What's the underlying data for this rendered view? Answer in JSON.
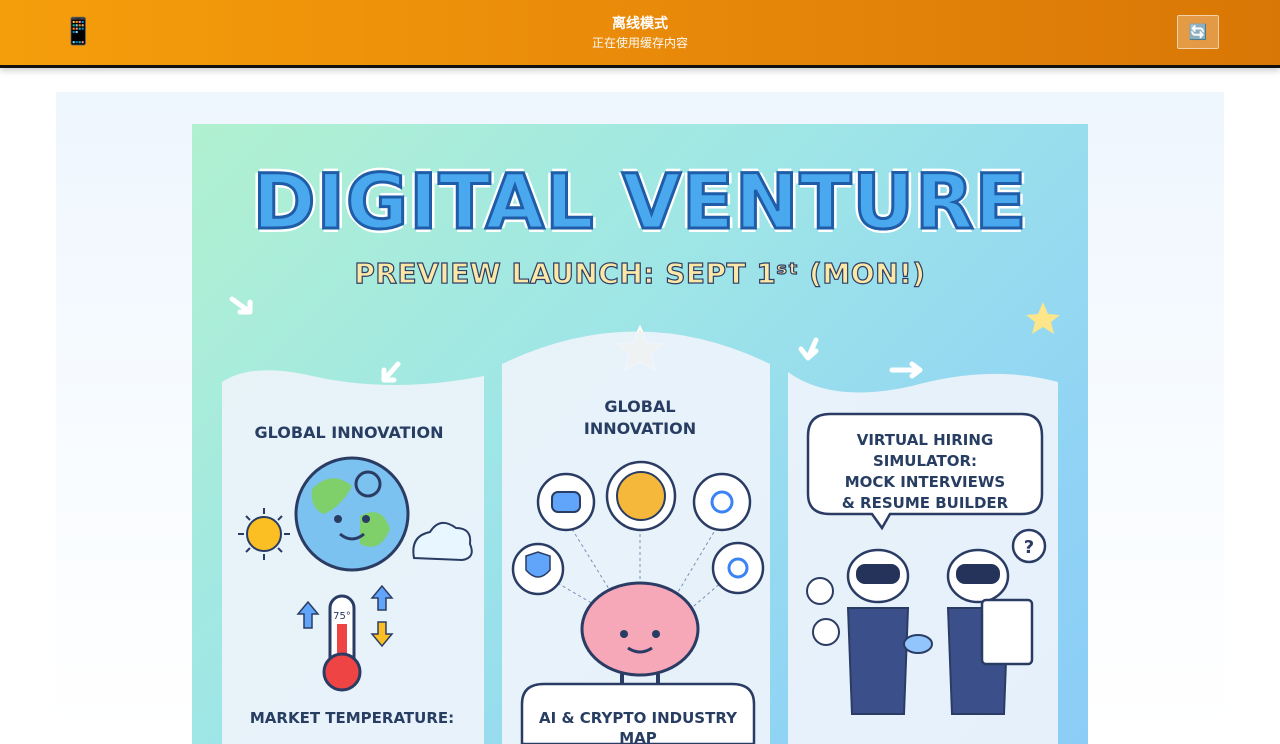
{
  "header": {
    "device_icon": "📱",
    "title": "离线模式",
    "subtitle": "正在使用缓存内容",
    "refresh_icon": "🔄",
    "refresh_icon_name": "refresh-icon"
  },
  "poster": {
    "heading": "DIGITAL VENTURE",
    "launch_text": "PREVIEW LAUNCH: SEPT 1ˢᵗ (MON!)",
    "panels": [
      {
        "title": "GLOBAL INNOVATION",
        "bottom_text": "MARKET TEMPERATURE:"
      },
      {
        "title_line1": "GLOBAL",
        "title_line2": "INNOVATION",
        "bottom_text": "AI & CRYPTO INDUSTRY MAP"
      },
      {
        "bubble_line1": "VIRTUAL HIRING SIMULATOR:",
        "bubble_line2": "MOCK INTERVIEWS",
        "bubble_line3": "& RESUME BUILDER"
      }
    ],
    "thermometer_label": "75°"
  },
  "colors": {
    "header_start": "#f59e0b",
    "header_end": "#d97706",
    "heading_fill": "#4aa8ee",
    "heading_stroke": "#1f5da8",
    "text_dark": "#283d62"
  }
}
